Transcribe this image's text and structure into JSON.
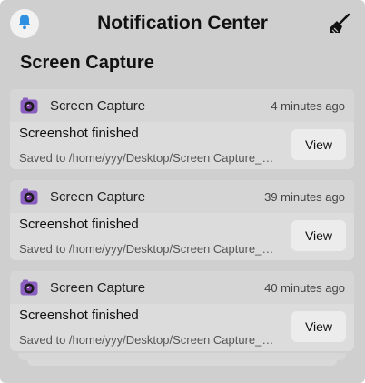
{
  "header": {
    "title": "Notification Center",
    "bell_icon": "bell-icon",
    "clear_icon": "broom-icon",
    "accent_color": "#2f8fe0"
  },
  "group": {
    "app_name": "Screen Capture"
  },
  "notifications": [
    {
      "app_name": "Screen Capture",
      "time": "4 minutes ago",
      "summary": "Screenshot finished",
      "body": "Saved to /home/yyy/Desktop/Screen Capture_…",
      "action_label": "View"
    },
    {
      "app_name": "Screen Capture",
      "time": "39 minutes ago",
      "summary": "Screenshot finished",
      "body": "Saved to /home/yyy/Desktop/Screen Capture_…",
      "action_label": "View"
    },
    {
      "app_name": "Screen Capture",
      "time": "40 minutes ago",
      "summary": "Screenshot finished",
      "body": "Saved to /home/yyy/Desktop/Screen Capture_…",
      "action_label": "View"
    }
  ]
}
